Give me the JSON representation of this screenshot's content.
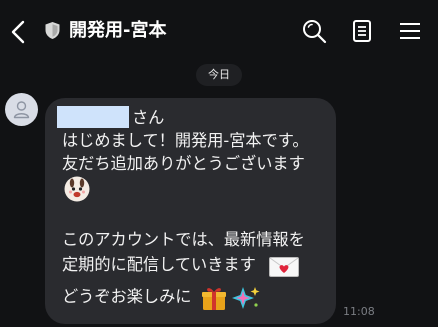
{
  "header": {
    "title": "開発用-宮本",
    "back_icon": "back-chevron-icon",
    "badge_icon": "shield-icon",
    "actions": [
      "search-icon",
      "notes-icon",
      "menu-icon"
    ]
  },
  "date_separator": "今日",
  "message": {
    "sender_avatar_icon": "person-icon",
    "greeting_suffix": "さん",
    "line2": "はじめまして！開発用-宮本です。",
    "line3": "友だち追加ありがとうございます",
    "line5": "このアカウントでは、最新情報を",
    "line6": "定期的に配信していきます",
    "line7": "どうぞお楽しみに",
    "emoji_icons": [
      "bunny-face-icon",
      "envelope-heart-icon",
      "gift-icon",
      "sparkle-star-icon"
    ],
    "time": "11:08"
  },
  "colors": {
    "background": "#111214",
    "bubble": "#2a2b2f",
    "name_highlight": "#cfe3fb",
    "timestamp": "#7a7d83"
  }
}
